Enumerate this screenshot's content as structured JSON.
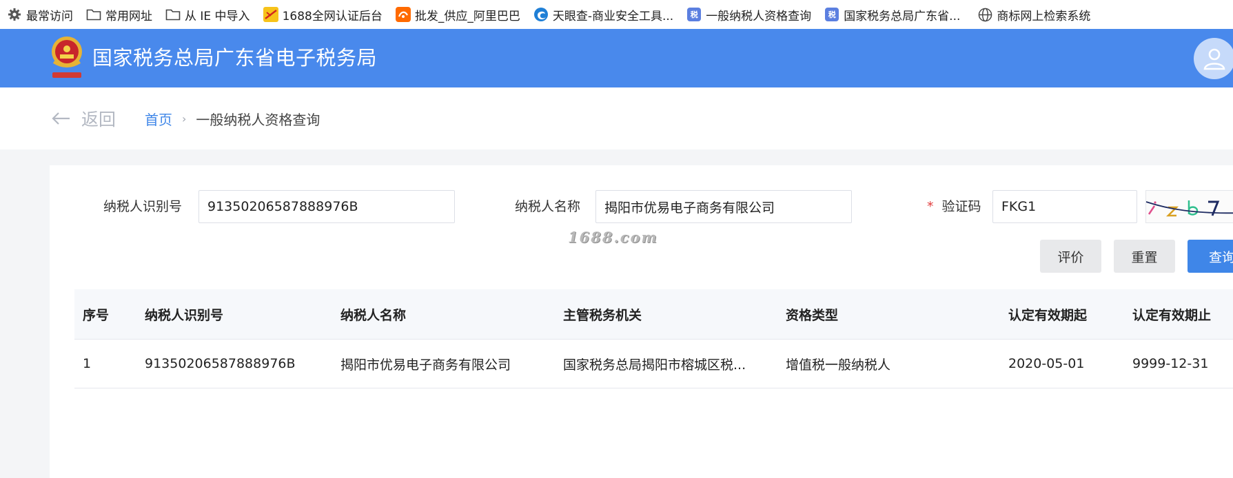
{
  "bookmarks": [
    {
      "label": "最常访问",
      "icon": "gear-icon"
    },
    {
      "label": "常用网址",
      "icon": "folder-icon"
    },
    {
      "label": "从 IE 中导入",
      "icon": "folder-icon"
    },
    {
      "label": "1688全网认证后台",
      "icon": "1688-logo-icon"
    },
    {
      "label": "批发_供应_阿里巴巴",
      "icon": "alibaba-logo-icon"
    },
    {
      "label": "天眼查-商业安全工具...",
      "icon": "edge-icon"
    },
    {
      "label": "一般纳税人资格查询",
      "icon": "tax-logo-icon",
      "tile_text": "税"
    },
    {
      "label": "国家税务总局广东省...",
      "icon": "tax-logo-icon",
      "tile_text": "税"
    },
    {
      "label": "商标网上检索系统",
      "icon": "globe-icon"
    }
  ],
  "header": {
    "title": "国家税务总局广东省电子税务局",
    "accent_color": "#4989ec"
  },
  "breadcrumb": {
    "back_label": "返回",
    "home": "首页",
    "separator": "›",
    "current": "一般纳税人资格查询"
  },
  "form": {
    "taxpayer_id_label": "纳税人识别号",
    "taxpayer_id_value": "91350206587888976B",
    "taxpayer_name_label": "纳税人名称",
    "taxpayer_name_value": "揭阳市优易电子商务有限公司",
    "captcha_required_mark": "*",
    "captcha_label": "验证码",
    "captcha_value": "FKG1"
  },
  "watermark": "1688.com",
  "buttons": {
    "evaluate": "评价",
    "reset": "重置",
    "query": "查询"
  },
  "table": {
    "columns": [
      "序号",
      "纳税人识别号",
      "纳税人名称",
      "主管税务机关",
      "资格类型",
      "认定有效期起",
      "认定有效期止"
    ],
    "rows": [
      [
        "1",
        "91350206587888976B",
        "揭阳市优易电子商务有限公司",
        "国家税务总局揭阳市榕城区税...",
        "增值税一般纳税人",
        "2020-05-01",
        "9999-12-31"
      ]
    ]
  }
}
